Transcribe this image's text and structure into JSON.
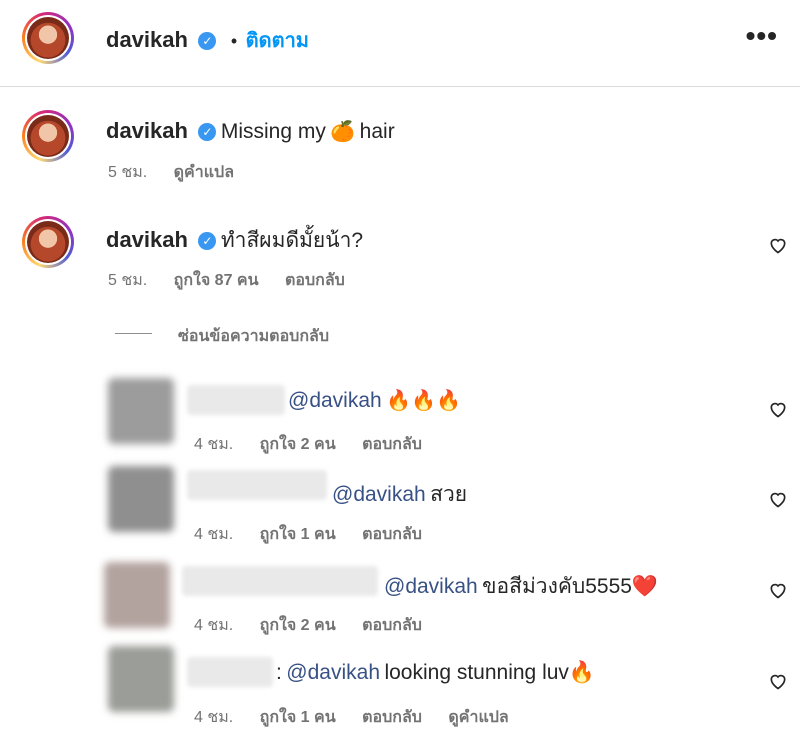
{
  "header": {
    "username": "davikah",
    "follow_label": "ติดตาม",
    "more_icon": "•••"
  },
  "caption": {
    "username": "davikah",
    "text_before": "Missing my",
    "emoji": "🍊",
    "text_after": "hair",
    "time": "5 ชม.",
    "translate": "ดูคำแปล"
  },
  "comment": {
    "username": "davikah",
    "text": "ทำสีผมดีมั้ยน้า?",
    "time": "5 ชม.",
    "likes": "ถูกใจ 87 คน",
    "reply": "ตอบกลับ"
  },
  "hide_replies_label": "ซ่อนข้อความตอบกลับ",
  "replies": [
    {
      "mention": "@davikah",
      "text": "🔥🔥🔥",
      "time": "4 ชม.",
      "likes": "ถูกใจ 2 คน",
      "reply": "ตอบกลับ",
      "avatar_color": "#9c9c9c"
    },
    {
      "mention": "@davikah",
      "text": "สวย",
      "time": "4 ชม.",
      "likes": "ถูกใจ 1 คน",
      "reply": "ตอบกลับ",
      "avatar_color": "#8f8f8f"
    },
    {
      "mention": "@davikah",
      "text": "ขอสีม่วงคับ5555❤️",
      "time": "4 ชม.",
      "likes": "ถูกใจ 2 คน",
      "reply": "ตอบกลับ",
      "avatar_color": "#b3a39f"
    },
    {
      "prefix": ":",
      "mention": "@davikah",
      "text": "looking stunning luv🔥",
      "time": "4 ชม.",
      "likes": "ถูกใจ 1 คน",
      "reply": "ตอบกลับ",
      "translate": "ดูคำแปล",
      "avatar_color": "#9a9d98"
    }
  ]
}
